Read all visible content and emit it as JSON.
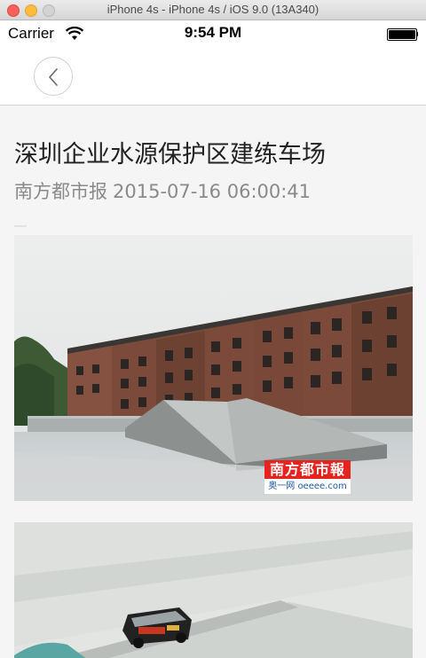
{
  "window": {
    "title": "iPhone 4s - iPhone 4s / iOS 9.0 (13A340)"
  },
  "status_bar": {
    "carrier": "Carrier",
    "time": "9:54 PM",
    "icons": [
      "wifi-icon",
      "battery-icon"
    ]
  },
  "navbar": {
    "back_icon": "chevron-left-icon"
  },
  "article": {
    "title": "深圳企业水源保护区建练车场",
    "source": "南方都市报",
    "datetime": "2015-07-16 06:00:41",
    "images": [
      {
        "watermark_top": "南方都市報",
        "watermark_bottom": "奥一网 oeeee.com"
      },
      {}
    ]
  },
  "colors": {
    "title": "#222222",
    "meta": "#8a8a8a",
    "background": "#f5f5f5",
    "watermark_red": "#e6231f"
  }
}
